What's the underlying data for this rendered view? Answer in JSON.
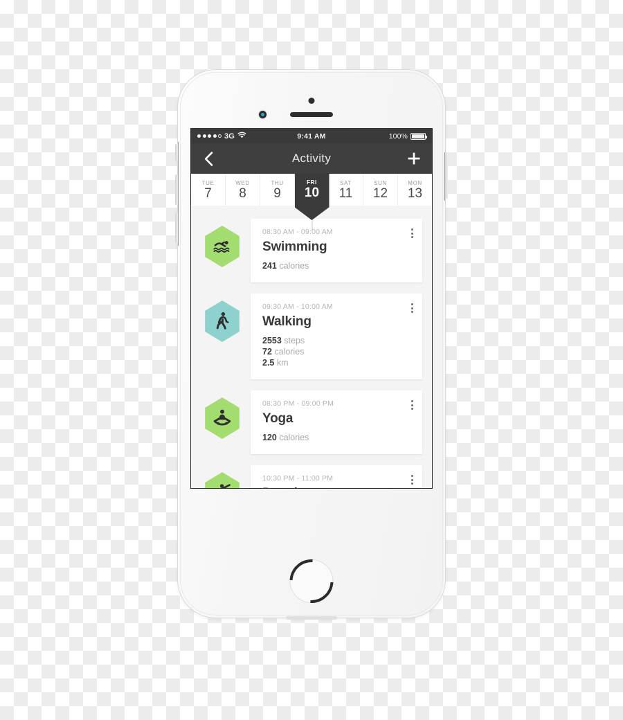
{
  "status_bar": {
    "signal_dots_filled": 4,
    "signal_dots_total": 5,
    "carrier": "3G",
    "wifi_icon": "wifi-icon",
    "time": "9:41 AM",
    "battery_percent": "100%",
    "battery_level": 100
  },
  "nav": {
    "back_icon": "chevron-left-icon",
    "title": "Activity",
    "add_icon": "plus-icon"
  },
  "date_strip": {
    "days": [
      {
        "dow": "TUE",
        "num": "7",
        "active": false
      },
      {
        "dow": "WED",
        "num": "8",
        "active": false
      },
      {
        "dow": "THU",
        "num": "9",
        "active": false
      },
      {
        "dow": "FRI",
        "num": "10",
        "active": true
      },
      {
        "dow": "SAT",
        "num": "11",
        "active": false
      },
      {
        "dow": "SUN",
        "num": "12",
        "active": false
      },
      {
        "dow": "MON",
        "num": "13",
        "active": false
      }
    ]
  },
  "activities": [
    {
      "time": "08:30 AM - 09:00 AM",
      "name": "Swimming",
      "icon": "swimming-icon",
      "hex_color": "#a3dd6f",
      "metrics": [
        {
          "value": "241",
          "unit": " calories"
        }
      ]
    },
    {
      "time": "09:30 AM - 10:00 AM",
      "name": "Walking",
      "icon": "walking-icon",
      "hex_color": "#8ed2cf",
      "metrics": [
        {
          "value": "2553",
          "unit": " steps"
        },
        {
          "value": "72",
          "unit": " calories"
        },
        {
          "value": "2.5",
          "unit": " km"
        }
      ]
    },
    {
      "time": "08:30 PM - 09:00 PM",
      "name": "Yoga",
      "icon": "yoga-icon",
      "hex_color": "#a3dd6f",
      "metrics": [
        {
          "value": "120",
          "unit": " calories"
        }
      ]
    },
    {
      "time": "10:30 PM - 11:00 PM",
      "name": "Dancing",
      "icon": "dancing-icon",
      "hex_color": "#a3dd6f",
      "metrics": []
    }
  ],
  "card_menu_icon": "kebab-menu-icon",
  "hardware": {
    "camera": "front-camera",
    "speaker": "earpiece-speaker",
    "sensor": "proximity-sensor",
    "home_button": "home-button",
    "silent_switch": "silent-switch",
    "volume_up": "volume-up-button",
    "volume_down": "volume-down-button",
    "power_button": "power-button"
  },
  "colors": {
    "nav_bg": "#3f3f3f",
    "status_bg": "#3a3a3a",
    "accent_green": "#a3dd6f",
    "accent_teal": "#8ed2cf",
    "screen_bg": "#f4f4f4",
    "text_dark": "#3a3a3a",
    "text_muted": "#a9a9a9"
  }
}
